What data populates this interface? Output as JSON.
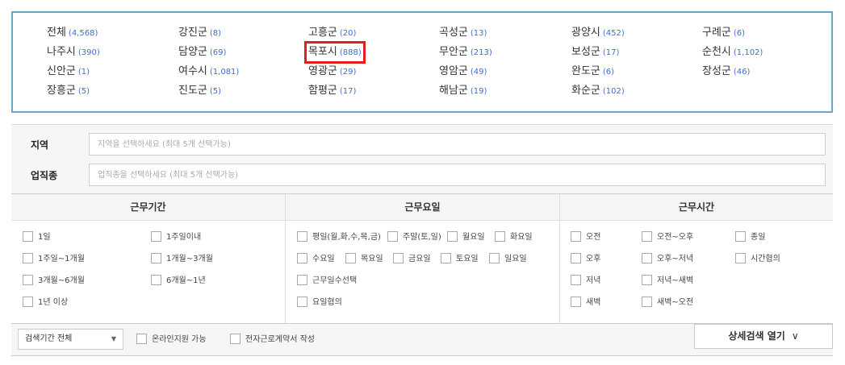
{
  "regions": [
    {
      "name": "전체",
      "count": "(4,568)"
    },
    {
      "name": "강진군",
      "count": "(8)"
    },
    {
      "name": "고흥군",
      "count": "(20)"
    },
    {
      "name": "곡성군",
      "count": "(13)"
    },
    {
      "name": "광양시",
      "count": "(452)"
    },
    {
      "name": "구례군",
      "count": "(6)"
    },
    {
      "name": "나주시",
      "count": "(390)"
    },
    {
      "name": "담양군",
      "count": "(69)"
    },
    {
      "name": "목포시",
      "count": "(888)",
      "selected": true
    },
    {
      "name": "무안군",
      "count": "(213)"
    },
    {
      "name": "보성군",
      "count": "(17)"
    },
    {
      "name": "순천시",
      "count": "(1,102)"
    },
    {
      "name": "신안군",
      "count": "(1)"
    },
    {
      "name": "여수시",
      "count": "(1,081)"
    },
    {
      "name": "영광군",
      "count": "(29)"
    },
    {
      "name": "영암군",
      "count": "(49)"
    },
    {
      "name": "완도군",
      "count": "(6)"
    },
    {
      "name": "장성군",
      "count": "(46)"
    },
    {
      "name": "장흥군",
      "count": "(5)"
    },
    {
      "name": "진도군",
      "count": "(5)"
    },
    {
      "name": "함평군",
      "count": "(17)"
    },
    {
      "name": "해남군",
      "count": "(19)"
    },
    {
      "name": "화순군",
      "count": "(102)"
    }
  ],
  "search": {
    "region_label": "지역",
    "region_placeholder": "지역을 선택하세요 (최대 5개 선택가능)",
    "job_label": "업직종",
    "job_placeholder": "업직종을 선택하세요 (최대 5개 선택가능)"
  },
  "filters": {
    "period": {
      "title": "근무기간",
      "options": [
        "1일",
        "1주일이내",
        "1주일~1개월",
        "1개월~3개월",
        "3개월~6개월",
        "6개월~1년",
        "1년 이상"
      ]
    },
    "days": {
      "title": "근무요일",
      "options": [
        "평일(월,화,수,목,금)",
        "주말(토,일)",
        "월요일",
        "화요일",
        "수요일",
        "목요일",
        "금요일",
        "토요일",
        "일요일",
        "근무일수선택",
        "요일협의"
      ]
    },
    "hours": {
      "title": "근무시간",
      "options": [
        "오전",
        "오전~오후",
        "종일",
        "오후",
        "오후~저녁",
        "시간협의",
        "저녁",
        "저녁~새벽",
        "새벽",
        "새벽~오전"
      ]
    }
  },
  "bottom": {
    "period_select": "검색기간 전체",
    "online_support": "온라인지원 가능",
    "e_contract": "전자근로계약서 작성",
    "detail_button": "상세검색 열기"
  },
  "colors": {
    "border_accent": "#6fa6c8",
    "count_blue": "#3f6ed0",
    "selected_red": "#e02020"
  }
}
